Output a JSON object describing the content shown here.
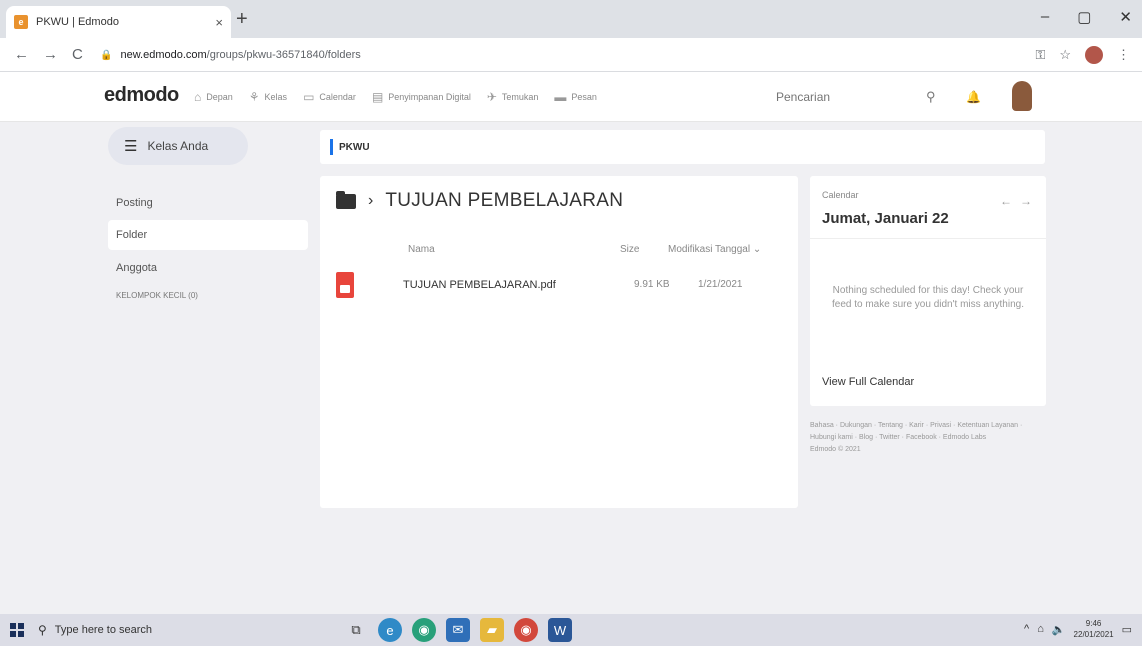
{
  "browser": {
    "tab_title": "PKWU | Edmodo",
    "tab_close": "×",
    "new_tab": "+",
    "favicon_letter": "e",
    "url_host": "new.edmodo.com",
    "url_path": "/groups/pkwu-36571840/folders",
    "window_controls": [
      "–",
      "▢",
      "✕"
    ],
    "nav_buttons": [
      "←",
      "→",
      "C"
    ],
    "addr_icons": [
      "key-icon",
      "star-icon",
      "profile-icon",
      "menu-icon"
    ]
  },
  "header": {
    "logo": "edmodo",
    "nav": [
      {
        "label": "Depan",
        "icon": "home-icon"
      },
      {
        "label": "Kelas",
        "icon": "classes-icon"
      },
      {
        "label": "Calendar",
        "icon": "calendar-icon"
      },
      {
        "label": "Penyimpanan Digital",
        "icon": "storage-icon"
      },
      {
        "label": "Temukan",
        "icon": "discover-icon"
      },
      {
        "label": "Pesan",
        "icon": "message-icon"
      }
    ],
    "search_placeholder": "Pencarian"
  },
  "sidebar": {
    "class_button": "Kelas Anda",
    "items": [
      {
        "label": "Posting",
        "active": false
      },
      {
        "label": "Folder",
        "active": true
      },
      {
        "label": "Anggota",
        "active": false
      },
      {
        "label": "KELOMPOK KECIL (0)",
        "active": false
      }
    ]
  },
  "breadcrumb": "PKWU",
  "folder": {
    "title": "TUJUAN PEMBELAJARAN",
    "columns": {
      "name": "Nama",
      "size": "Size",
      "modified": "Modifikasi Tanggal ⌄"
    },
    "files": [
      {
        "name": "TUJUAN PEMBELAJARAN.pdf",
        "size": "9.91 KB",
        "date": "1/21/2021"
      }
    ]
  },
  "calendar": {
    "label": "Calendar",
    "date": "Jumat, Januari 22",
    "empty_message": "Nothing scheduled for this day! Check your feed to make sure you didn't miss anything.",
    "link": "View Full Calendar"
  },
  "footer": {
    "links": "Bahasa · Dukungan · Tentang · Karir · Privasi · Ketentuan Layanan · Hubungi kami · Blog · Twitter · Facebook · Edmodo Labs",
    "copyright": "Edmodo © 2021"
  },
  "taskbar": {
    "search_placeholder": "Type here to search",
    "time": "9:46",
    "date": "22/01/2021",
    "apps": [
      {
        "icon": "task-view-icon",
        "color": "#dcdde6"
      },
      {
        "icon": "edge-icon",
        "color": "#2f8ac7"
      },
      {
        "icon": "chrome-alt-icon",
        "color": "#28a07a"
      },
      {
        "icon": "mail-icon",
        "color": "#2f6fb8"
      },
      {
        "icon": "file-explorer-icon",
        "color": "#e6b83c"
      },
      {
        "icon": "chrome-icon",
        "color": "#d2483c"
      },
      {
        "icon": "word-icon",
        "color": "#2b5797"
      }
    ]
  }
}
